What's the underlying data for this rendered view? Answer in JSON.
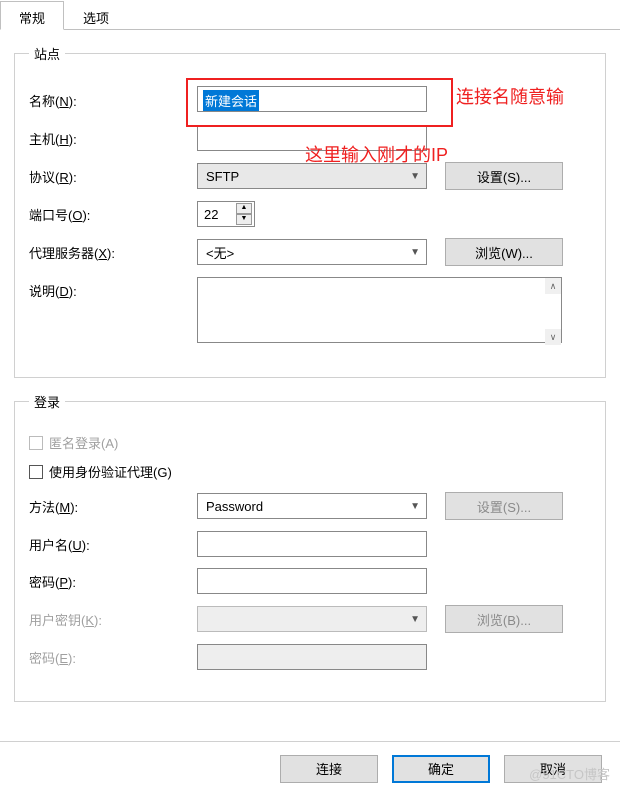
{
  "tabs": {
    "general": "常规",
    "options": "选项"
  },
  "site": {
    "legend": "站点",
    "name_label_pre": "名称(",
    "name_label_u": "N",
    "name_label_post": "):",
    "name_value": "新建会话",
    "host_label_pre": "主机(",
    "host_label_u": "H",
    "host_label_post": "):",
    "host_value": "",
    "proto_label_pre": "协议(",
    "proto_label_u": "R",
    "proto_label_post": "):",
    "proto_value": "SFTP",
    "proto_btn_pre": "设置(",
    "proto_btn_u": "S",
    "proto_btn_post": ")...",
    "port_label_pre": "端口号(",
    "port_label_u": "O",
    "port_label_post": "):",
    "port_value": "22",
    "proxy_label_pre": "代理服务器(",
    "proxy_label_u": "X",
    "proxy_label_post": "):",
    "proxy_value": "<无>",
    "proxy_btn_pre": "浏览(",
    "proxy_btn_u": "W",
    "proxy_btn_post": ")...",
    "desc_label_pre": "说明(",
    "desc_label_u": "D",
    "desc_label_post": "):",
    "desc_value": ""
  },
  "login": {
    "legend": "登录",
    "anon_pre": "匿名登录(",
    "anon_u": "A",
    "anon_post": ")",
    "authagent_pre": "使用身份验证代理(",
    "authagent_u": "G",
    "authagent_post": ")",
    "method_label_pre": "方法(",
    "method_label_u": "M",
    "method_label_post": "):",
    "method_value": "Password",
    "method_btn_pre": "设置(",
    "method_btn_u": "S",
    "method_btn_post": ")...",
    "user_label_pre": "用户名(",
    "user_label_u": "U",
    "user_label_post": "):",
    "user_value": "",
    "pass_label_pre": "密码(",
    "pass_label_u": "P",
    "pass_label_post": "):",
    "pass_value": "",
    "ukey_label_pre": "用户密钥(",
    "ukey_label_u": "K",
    "ukey_label_post": "):",
    "ukey_btn_pre": "浏览(",
    "ukey_btn_u": "B",
    "ukey_btn_post": ")...",
    "kpass_label_pre": "密码(",
    "kpass_label_u": "E",
    "kpass_label_post": "):"
  },
  "footer": {
    "connect": "连接",
    "ok": "确定",
    "cancel": "取消"
  },
  "annotations": {
    "a1": "连接名随意输",
    "a2": "这里输入刚才的IP"
  },
  "watermark": "@51CTO博客"
}
